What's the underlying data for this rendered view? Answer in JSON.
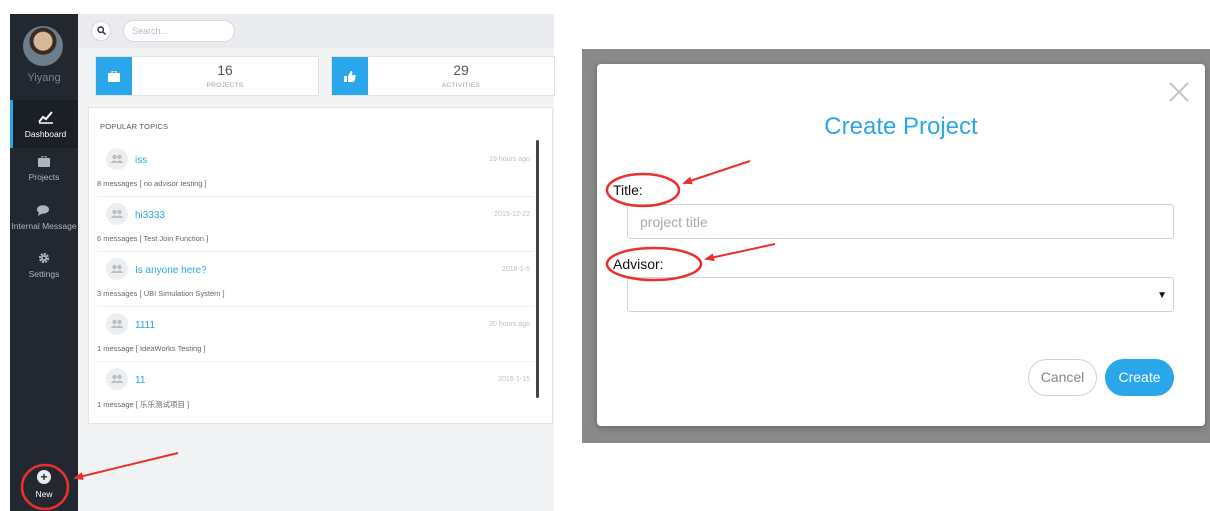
{
  "sidebar": {
    "username": "Yiyang",
    "items": [
      {
        "label": "Dashboard",
        "icon": "line-chart-icon"
      },
      {
        "label": "Projects",
        "icon": "briefcase-icon"
      },
      {
        "label": "Internal Message",
        "icon": "chat-icon"
      },
      {
        "label": "Settings",
        "icon": "gear-icon"
      }
    ],
    "new_label": "New"
  },
  "search": {
    "placeholder": "Search..."
  },
  "stats": [
    {
      "value": "16",
      "label": "PROJECTS",
      "icon": "briefcase-icon"
    },
    {
      "value": "29",
      "label": "ACTIVITIES",
      "icon": "thumbs-up-icon"
    }
  ],
  "topics": {
    "title": "POPULAR TOPICS",
    "items": [
      {
        "title": "iss",
        "time": "19 hours ago",
        "meta": "8 messages   [ no advisor testing ]"
      },
      {
        "title": "hi3333",
        "time": "2015-12-22",
        "meta": "6 messages   [ Test Join Function ]"
      },
      {
        "title": "Is anyone here?",
        "time": "2016-1-5",
        "meta": "3 messages   [ UBI Simulation System ]"
      },
      {
        "title": "1111",
        "time": "20 hours ago",
        "meta": "1 message   [ IdeaWorks Testing ]"
      },
      {
        "title": "11",
        "time": "2016-1-15",
        "meta": "1 message   [ 乐乐测试项目 ]"
      }
    ]
  },
  "modal": {
    "title": "Create Project",
    "title_label": "Title:",
    "title_placeholder": "project title",
    "advisor_label": "Advisor:",
    "advisor_value": "",
    "cancel_label": "Cancel",
    "create_label": "Create"
  },
  "colors": {
    "accent": "#2aa7ea",
    "sidebar": "#232830",
    "annotation": "#e8302d"
  }
}
